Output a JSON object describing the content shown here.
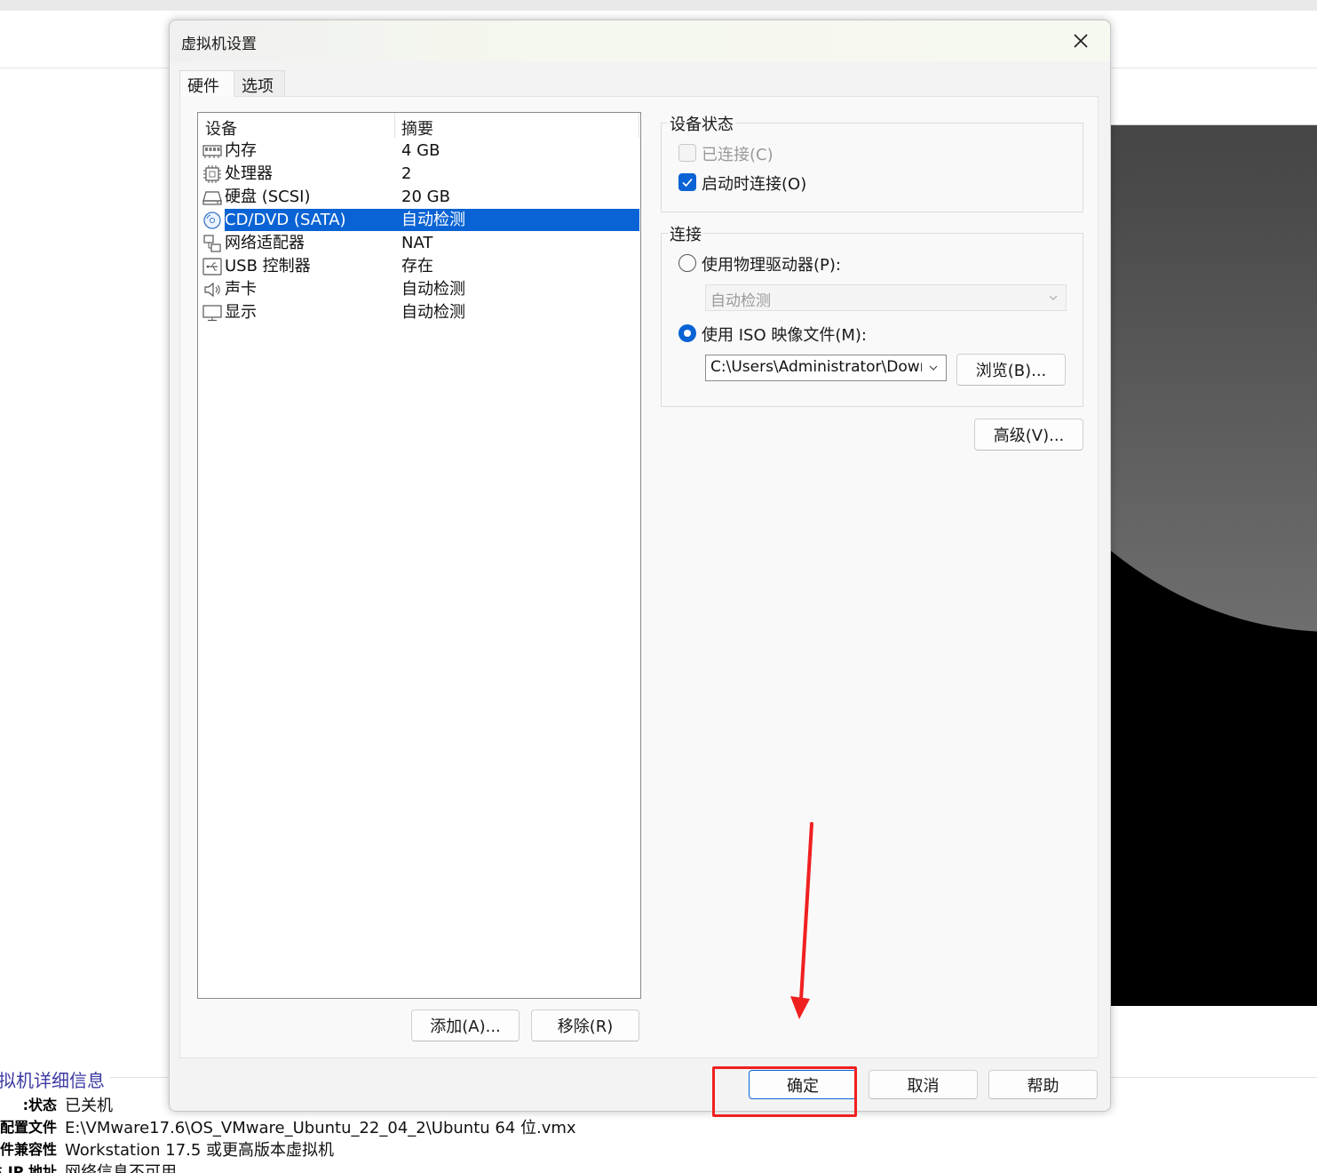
{
  "dialog": {
    "title": "虚拟机设置",
    "tabs": [
      {
        "label": "硬件",
        "active": true
      },
      {
        "label": "选项",
        "active": false
      }
    ],
    "device_list": {
      "headers": {
        "device": "设备",
        "summary": "摘要"
      },
      "rows": [
        {
          "name": "内存",
          "summary": "4 GB",
          "icon": "memory-icon"
        },
        {
          "name": "处理器",
          "summary": "2",
          "icon": "cpu-icon"
        },
        {
          "name": "硬盘 (SCSI)",
          "summary": "20 GB",
          "icon": "hard-disk-icon"
        },
        {
          "name": "CD/DVD (SATA)",
          "summary": "自动检测",
          "icon": "cd-dvd-icon",
          "selected": true
        },
        {
          "name": "网络适配器",
          "summary": "NAT",
          "icon": "network-adapter-icon"
        },
        {
          "name": "USB 控制器",
          "summary": "存在",
          "icon": "usb-icon"
        },
        {
          "name": "声卡",
          "summary": "自动检测",
          "icon": "speaker-icon"
        },
        {
          "name": "显示",
          "summary": "自动检测",
          "icon": "monitor-icon"
        }
      ],
      "add_button": "添加(A)...",
      "remove_button": "移除(R)"
    },
    "device_status": {
      "title": "设备状态",
      "connected_label": "已连接(C)",
      "connected_checked": false,
      "connected_disabled": true,
      "connect_at_power_on_label": "启动时连接(O)",
      "connect_at_power_on_checked": true
    },
    "connection": {
      "title": "连接",
      "physical_label": "使用物理驱动器(P):",
      "physical_selected": false,
      "physical_value": "自动检测",
      "iso_label": "使用 ISO 映像文件(M):",
      "iso_selected": true,
      "iso_path": "C:\\Users\\Administrator\\Downloads",
      "browse_button": "浏览(B)..."
    },
    "advanced_button": "高级(V)...",
    "footer": {
      "ok_button": "确定",
      "cancel_button": "取消",
      "help_button": "帮助"
    }
  },
  "background": {
    "details_title": "拟机详细信息",
    "details": [
      {
        "key": "状态:",
        "value": "已关机"
      },
      {
        "key": "配置文件:",
        "value": "E:\\VMware17.6\\OS_VMware_Ubuntu_22_04_2\\Ubuntu 64 位.vmx"
      },
      {
        "key": "硬件兼容性:",
        "value": "Workstation 17.5 或更高版本虚拟机"
      },
      {
        "key": "主 IP 地址:",
        "value": "网络信息不可用"
      }
    ]
  },
  "colors": {
    "accent": "#0a63d4",
    "annotation": "#f02020"
  }
}
